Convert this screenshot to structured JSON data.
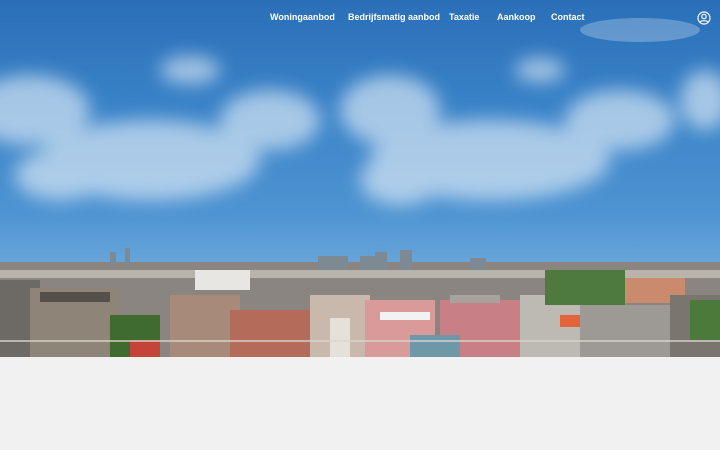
{
  "nav": {
    "items": [
      {
        "label": "Woningaanbod"
      },
      {
        "label": "Bedrijfsmatig aanbod"
      },
      {
        "label": "Taxatie"
      },
      {
        "label": "Aankoop"
      },
      {
        "label": "Contact"
      }
    ],
    "account_icon": "user-circle-icon"
  },
  "hero": {
    "image": "amsterdam-skyline-panorama"
  },
  "colors": {
    "sky_top": "#2a6fb8",
    "sky_bottom": "#8fbde2",
    "page_background": "#f1f1f1",
    "nav_text": "#ffffff"
  }
}
